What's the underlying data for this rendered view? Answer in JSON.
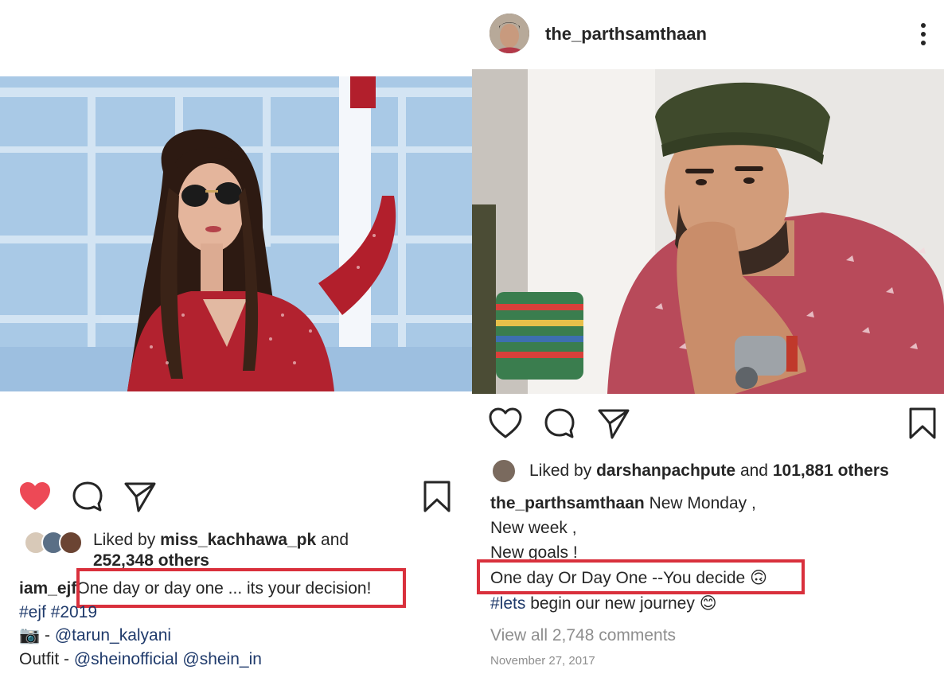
{
  "left_post": {
    "liked_by_prefix": "Liked by",
    "liked_by_user": "miss_kachhawa_pk",
    "liked_and": "and",
    "liked_count": "252,348 others",
    "caption_user": "iam_ejf",
    "caption_highlight": "One day or day one ... its your decision!",
    "hashtags": "#ejf #2019",
    "camera_emoji": "📷",
    "credit_sep": " - ",
    "credit_user": "@tarun_kalyani",
    "outfit_label": "Outfit - ",
    "outfit_user1": "@sheinofficial",
    "outfit_user2": "@shein_in",
    "liked_state": true,
    "heart_color": "#ed4956"
  },
  "right_post": {
    "username": "the_parthsamthaan",
    "liked_by_prefix": "Liked by",
    "liked_by_user": "darshanpachpute",
    "liked_and": "and",
    "liked_count": "101,881 others",
    "caption_user": "the_parthsamthaan",
    "caption_line1": "New Monday ,",
    "caption_line2": "New week ,",
    "caption_line3": "New goals !",
    "caption_highlight": "One day Or Day One --You decide",
    "upside_emoji": "🙃",
    "caption_line5_tag": "#lets",
    "caption_line5_rest": " begin our new journey",
    "smile_emoji": "😊",
    "view_comments": "View all 2,748 comments",
    "date": "November 27, 2017"
  },
  "colors": {
    "highlight_border": "#d9303c",
    "link_blue": "#1f3a6b",
    "muted": "#8e8e8e"
  }
}
